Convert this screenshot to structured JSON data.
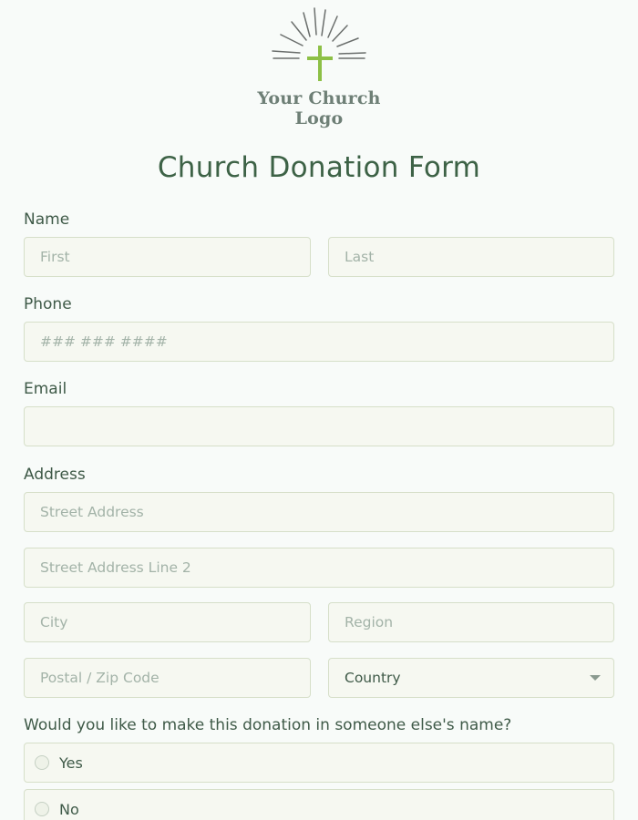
{
  "logo": {
    "text_line1": "Your Church",
    "text_line2": "Logo",
    "cross_color": "#8dc046",
    "ray_color": "#6a6e6c"
  },
  "form": {
    "title": "Church Donation Form",
    "name": {
      "label": "Name",
      "first_placeholder": "First",
      "last_placeholder": "Last"
    },
    "phone": {
      "label": "Phone",
      "placeholder": "### ### ####"
    },
    "email": {
      "label": "Email",
      "placeholder": ""
    },
    "address": {
      "label": "Address",
      "street_placeholder": "Street Address",
      "street2_placeholder": "Street Address Line 2",
      "city_placeholder": "City",
      "region_placeholder": "Region",
      "postal_placeholder": "Postal / Zip Code",
      "country_selected": "Country"
    },
    "donation_name_question": {
      "label": "Would you like to make this donation in someone else's name?",
      "options": [
        "Yes",
        "No"
      ]
    }
  },
  "colors": {
    "background": "#f8fbf9",
    "title": "#3d6246",
    "field_background": "#f6f8f1",
    "field_border": "#d6dfc9"
  }
}
